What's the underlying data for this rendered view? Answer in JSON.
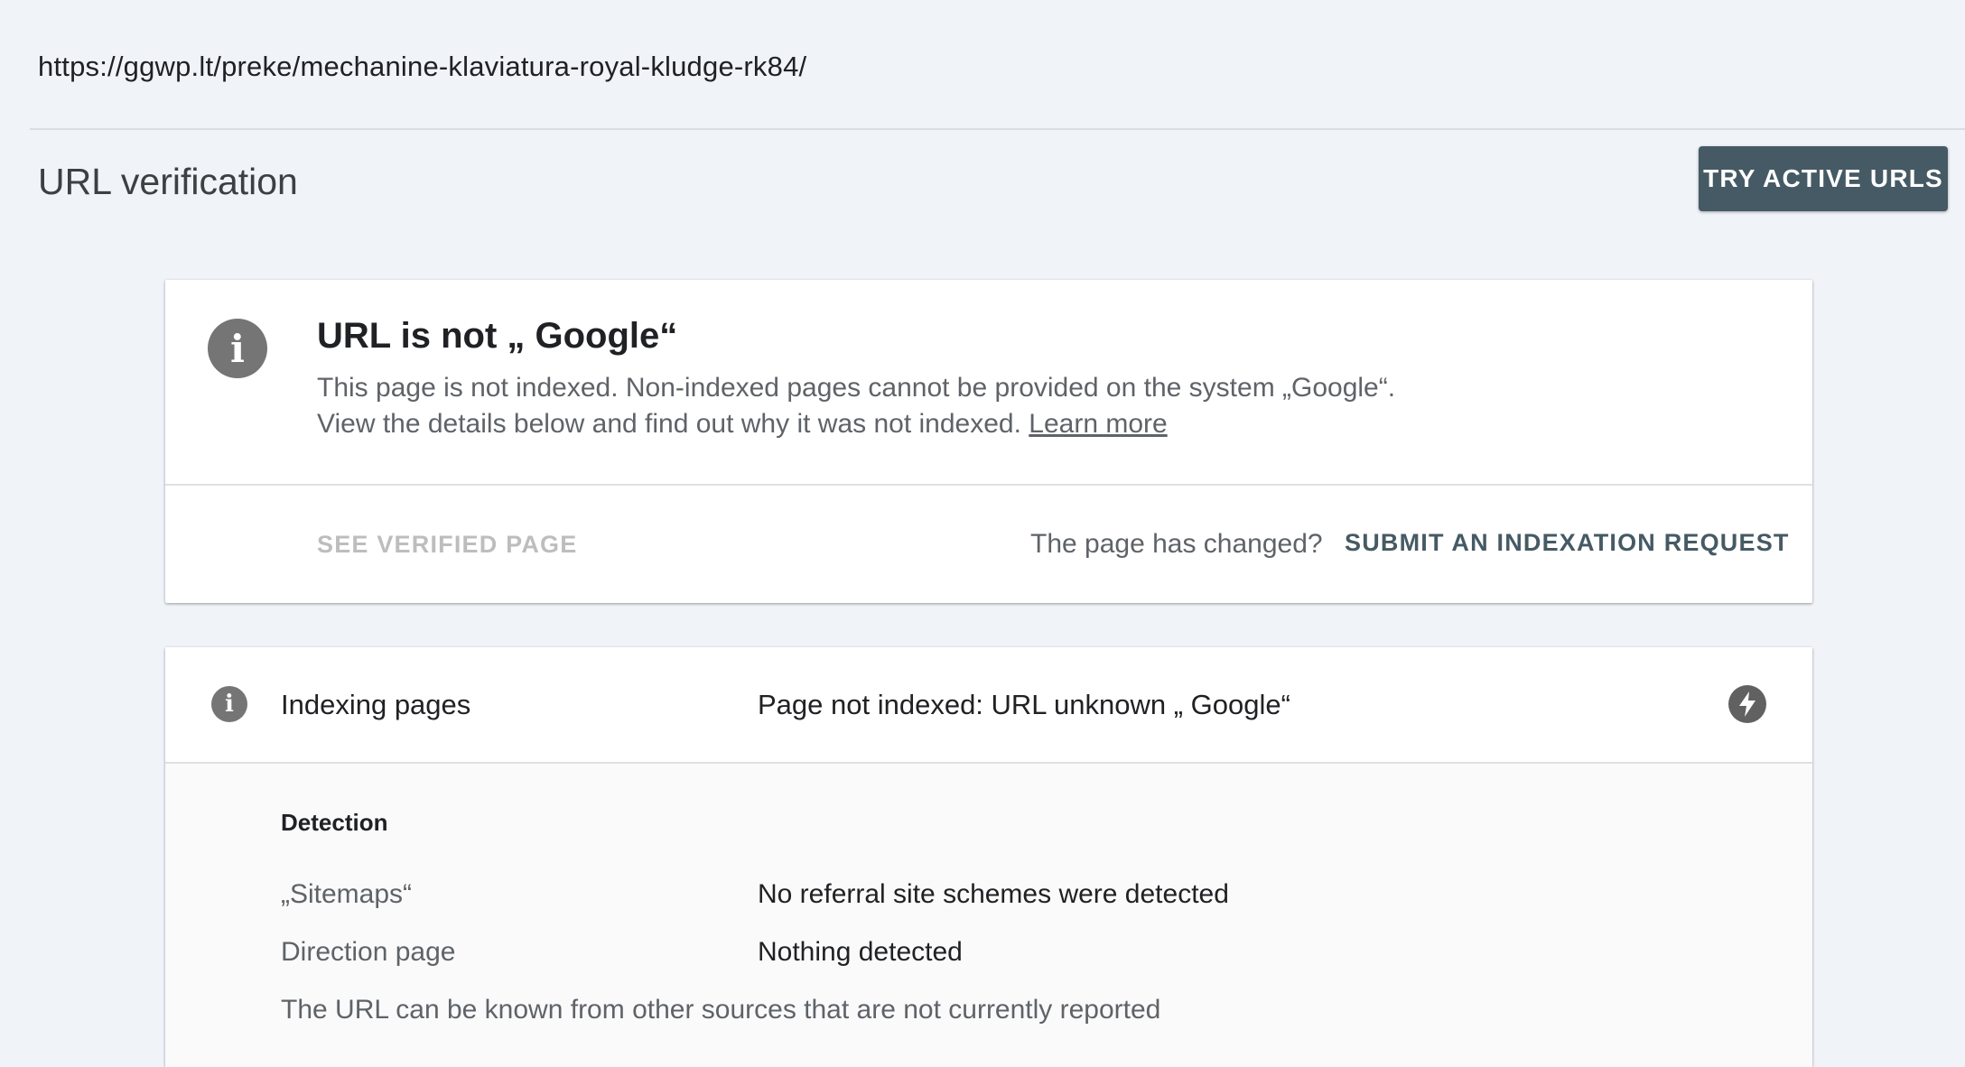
{
  "url": "https://ggwp.lt/preke/mechanine-klaviatura-royal-kludge-rk84/",
  "page_title": "URL verification",
  "try_button_label": "TRY ACTIVE URLS",
  "status": {
    "icon": "info-icon",
    "heading": "URL is not „ Google“",
    "description": "This page is not indexed. Non-indexed pages cannot be provided on the system „Google“. View the details below and find out why it was not indexed.",
    "learn_more": "Learn more",
    "see_verified_label": "SEE VERIFIED PAGE",
    "changed_text": "The page has changed?",
    "submit_label": "SUBMIT AN INDEXATION REQUEST"
  },
  "indexing": {
    "icon": "info-icon",
    "label": "Indexing pages",
    "value": "Page not indexed: URL unknown „ Google“",
    "action_icon": "bolt-icon",
    "section_title": "Detection",
    "rows": [
      {
        "label": "„Sitemaps“",
        "value": "No referral site schemes were detected"
      },
      {
        "label": "Direction page",
        "value": "Nothing detected"
      }
    ],
    "footnote": "The URL can be known from other sources that are not currently reported"
  },
  "colors": {
    "background": "#f0f4f9",
    "accent_button": "#455a64",
    "icon_grey": "#757575"
  }
}
